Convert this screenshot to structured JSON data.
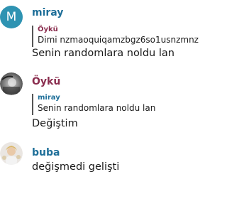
{
  "messages": [
    {
      "sender": "miray",
      "avatar_letter": "M",
      "quote": {
        "author": "Öykü",
        "text": "Dimi nzmaoquiqamzbgz6so1usnzmnz"
      },
      "text": "Senin randomlara noldu lan"
    },
    {
      "sender": "Öykü",
      "avatar_letter": "",
      "quote": {
        "author": "miray",
        "text": "Senin randomlara noldu lan"
      },
      "text": "Değiştim"
    },
    {
      "sender": "buba",
      "avatar_letter": "",
      "text": "değişmedi gelişti"
    }
  ],
  "colors": {
    "miray": "#1f6f99",
    "oyku": "#8a2d4e",
    "buba": "#1f6f99",
    "avatar_miray_bg": "#2e93b2"
  }
}
